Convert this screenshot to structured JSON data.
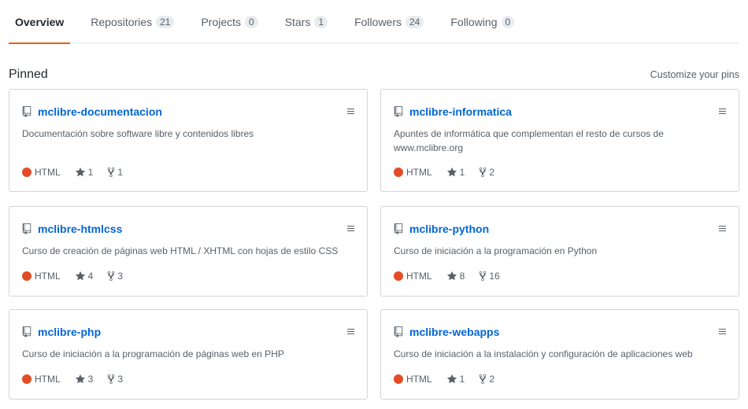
{
  "tabs": [
    {
      "label": "Overview",
      "count": null
    },
    {
      "label": "Repositories",
      "count": "21"
    },
    {
      "label": "Projects",
      "count": "0"
    },
    {
      "label": "Stars",
      "count": "1"
    },
    {
      "label": "Followers",
      "count": "24"
    },
    {
      "label": "Following",
      "count": "0"
    }
  ],
  "pinned": {
    "title": "Pinned",
    "customize_label": "Customize your pins"
  },
  "repos": [
    {
      "name": "mclibre-documentacion",
      "description": "Documentación sobre software libre y contenidos libres",
      "language": "HTML",
      "stars": "1",
      "forks": "1"
    },
    {
      "name": "mclibre-informatica",
      "description": "Apuntes de informática que complementan el resto de cursos de www.mclibre.org",
      "language": "HTML",
      "stars": "1",
      "forks": "2"
    },
    {
      "name": "mclibre-htmlcss",
      "description": "Curso de creación de páginas web HTML / XHTML con hojas de estilo CSS",
      "language": "HTML",
      "stars": "4",
      "forks": "3"
    },
    {
      "name": "mclibre-python",
      "description": "Curso de iniciación a la programación en Python",
      "language": "HTML",
      "stars": "8",
      "forks": "16"
    },
    {
      "name": "mclibre-php",
      "description": "Curso de iniciación a la programación de páginas web en PHP",
      "language": "HTML",
      "stars": "3",
      "forks": "3"
    },
    {
      "name": "mclibre-webapps",
      "description": "Curso de iniciación a la instalación y configuración de aplicaciones web",
      "language": "HTML",
      "stars": "1",
      "forks": "2"
    }
  ],
  "colors": {
    "accent": "#e36209",
    "link": "#0366d6",
    "html_language": "#e34c26"
  }
}
